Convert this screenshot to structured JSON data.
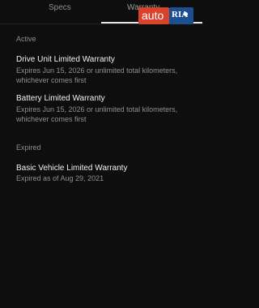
{
  "tabs": [
    {
      "label": "Specs"
    },
    {
      "label": "Warranty"
    }
  ],
  "watermark": {
    "auto": "auto",
    "ria": "RIA"
  },
  "sections": [
    {
      "label": "Active",
      "items": [
        {
          "title": "Drive Unit Limited Warranty",
          "subtitle": "Expires Jun 15, 2026 or unlimited total kilometers, whichever comes first"
        },
        {
          "title": "Battery Limited Warranty",
          "subtitle": "Expires Jun 15, 2026 or unlimited total kilometers, whichever comes first"
        }
      ]
    },
    {
      "label": "Expired",
      "items": [
        {
          "title": "Basic Vehicle Limited Warranty",
          "subtitle": "Expired as of Aug 29, 2021"
        }
      ]
    }
  ]
}
